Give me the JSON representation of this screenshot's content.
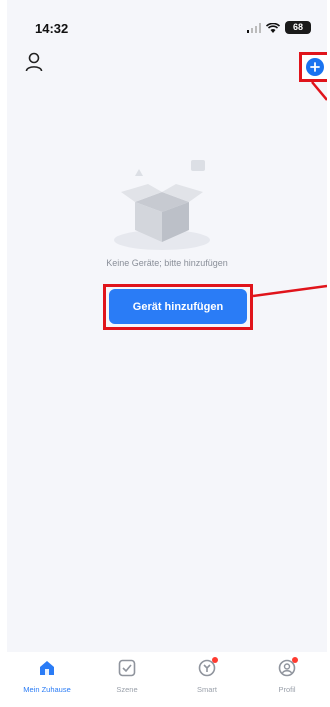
{
  "status_bar": {
    "time": "14:32",
    "battery": "68"
  },
  "header": {
    "user_icon": "person-icon",
    "add_icon": "plus-circle-icon"
  },
  "empty_state": {
    "message": "Keine Geräte; bitte hinzufügen",
    "button_label": "Gerät hinzufügen",
    "illustration": "empty-box-illustration"
  },
  "colors": {
    "accent": "#2a7cf6",
    "annotation": "#e0141b",
    "background": "#f5f6fa"
  },
  "tabs": [
    {
      "label": "Mein Zuhause",
      "icon": "home-icon",
      "active": true
    },
    {
      "label": "Szene",
      "icon": "scene-check-icon",
      "active": false
    },
    {
      "label": "Smart",
      "icon": "smart-icon",
      "active": false,
      "badge": true
    },
    {
      "label": "Profil",
      "icon": "profile-icon",
      "active": false,
      "badge": true
    }
  ]
}
